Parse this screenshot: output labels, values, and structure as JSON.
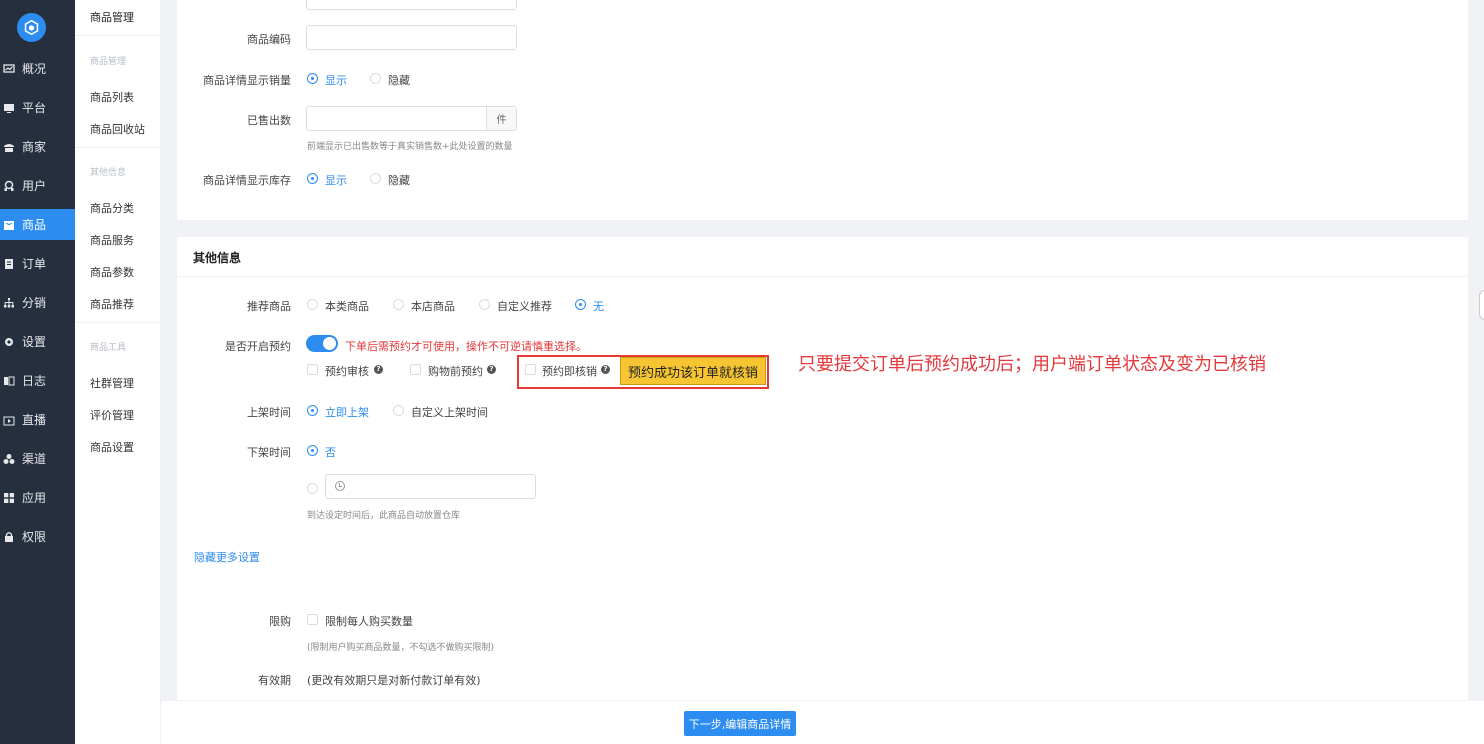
{
  "nav": {
    "items": [
      {
        "label": "概况",
        "icon": "chart-icon"
      },
      {
        "label": "平台",
        "icon": "monitor-icon"
      },
      {
        "label": "商家",
        "icon": "store-icon"
      },
      {
        "label": "用户",
        "icon": "user-icon"
      },
      {
        "label": "商品",
        "icon": "goods-icon",
        "active": true
      },
      {
        "label": "订单",
        "icon": "order-icon"
      },
      {
        "label": "分销",
        "icon": "distribution-icon"
      },
      {
        "label": "设置",
        "icon": "gear-icon"
      },
      {
        "label": "日志",
        "icon": "log-icon"
      },
      {
        "label": "直播",
        "icon": "live-icon"
      },
      {
        "label": "渠道",
        "icon": "channel-icon"
      },
      {
        "label": "应用",
        "icon": "apps-icon"
      },
      {
        "label": "权限",
        "icon": "lock-icon"
      }
    ]
  },
  "submenu": {
    "title": "商品管理",
    "group1": "商品管理",
    "group1_items": [
      "商品列表",
      "商品回收站"
    ],
    "group2": "其他信息",
    "group2_items": [
      "商品分类",
      "商品服务",
      "商品参数",
      "商品推荐"
    ],
    "group3": "商品工具",
    "group3_items": [
      "社群管理",
      "评价管理",
      "商品设置"
    ]
  },
  "form_top": {
    "code_label": "商品编码",
    "sales_display_label": "商品详情显示销量",
    "show": "显示",
    "hide": "隐藏",
    "sold_label": "已售出数",
    "sold_unit": "件",
    "sold_hint": "前端显示已出售数等于真实销售数+此处设置的数量",
    "stock_display_label": "商品详情显示库存"
  },
  "other": {
    "section_title": "其他信息",
    "recommend_label": "推荐商品",
    "recommend_options": [
      "本类商品",
      "本店商品",
      "自定义推荐",
      "无"
    ],
    "reserve_label": "是否开启预约",
    "reserve_warning": "下单后需预约才可使用，操作不可逆请慎重选择。",
    "reserve_audit": "预约审核",
    "reserve_before_buy": "购物前预约",
    "reserve_writeoff": "预约即核销",
    "callout_badge": "预约成功该订单就核销",
    "callout_note": "只要提交订单后预约成功后；用户端订单状态及变为已核销",
    "shelf_on_label": "上架时间",
    "shelf_on_options": [
      "立即上架",
      "自定义上架时间"
    ],
    "shelf_off_label": "下架时间",
    "shelf_off_no": "否",
    "shelf_off_hint": "到达设定时间后，此商品自动放置仓库",
    "hide_more": "隐藏更多设置",
    "limit_label": "限购",
    "limit_check": "限制每人购买数量",
    "limit_hint": "(限制用户购买商品数量，不勾选不做购买限制)",
    "valid_label": "有效期",
    "valid_note": "(更改有效期只是对新付款订单有效)"
  },
  "footer": {
    "next_button": "下一步,编辑商品详情"
  },
  "colors": {
    "primary": "#2d8cf0",
    "sidebar": "#262f3e",
    "warning": "#e4393c",
    "callout_bg": "#f7c531",
    "callout_border": "#e53935"
  }
}
